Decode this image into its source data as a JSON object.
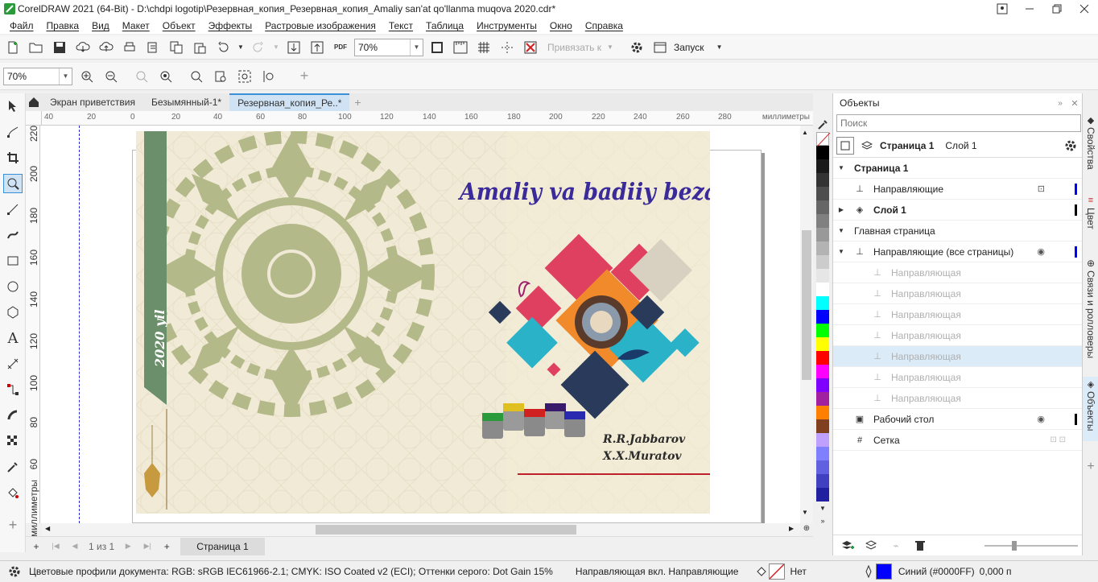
{
  "window": {
    "title": "CorelDRAW 2021 (64-Bit) - D:\\chdpi logotip\\Резервная_копия_Резервная_копия_Amaliy san'at qo'llanma muqova 2020.cdr*"
  },
  "menu": [
    "Файл",
    "Правка",
    "Вид",
    "Макет",
    "Объект",
    "Эффекты",
    "Растровые изображения",
    "Текст",
    "Таблица",
    "Инструменты",
    "Окно",
    "Справка"
  ],
  "stdbar": {
    "zoom": "70%",
    "snap_label": "Привязать к",
    "launch_label": "Запуск"
  },
  "propbar": {
    "zoom": "70%"
  },
  "doc_tabs": [
    "Экран приветствия",
    "Безымянный-1*",
    "Резервная_копия_Ре..*"
  ],
  "ruler": {
    "h_labels": [
      "40",
      "20",
      "0",
      "20",
      "40",
      "60",
      "80",
      "100",
      "120",
      "140",
      "160",
      "180",
      "200",
      "220",
      "240",
      "260",
      "280"
    ],
    "h_unit": "миллиметры",
    "v_labels": [
      "220",
      "200",
      "180",
      "160",
      "140",
      "120",
      "100",
      "80",
      "60"
    ],
    "v_unit": "миллиметры"
  },
  "cover": {
    "banner_text": "2020 yil",
    "title": "Amaliy va badiiy bezak san'ati",
    "authors": [
      "R.R.Jabbarov",
      "X.X.Muratov"
    ],
    "colors": {
      "banner": "#6b8f6b",
      "title": "#3a2a9a",
      "ornament": "#b4b98a",
      "pink": "#e04060",
      "orange": "#f08a2a",
      "teal": "#2ab3c8",
      "navy": "#2a3a5a",
      "red_line": "#c0202a"
    }
  },
  "pagebar": {
    "page_info": "1 из 1",
    "page_tab": "Страница 1"
  },
  "palette": [
    "#000000",
    "#1a1a1a",
    "#333333",
    "#4d4d4d",
    "#666666",
    "#808080",
    "#999999",
    "#b3b3b3",
    "#cccccc",
    "#e6e6e6",
    "#ffffff",
    "#00ffff",
    "#0000ff",
    "#00ff00",
    "#ffff00",
    "#ff0000",
    "#ff00ff",
    "#8000ff",
    "#a020a0",
    "#ff8000",
    "#804020",
    "#c0a0ff",
    "#8080ff",
    "#6060e0",
    "#4040c0",
    "#2020a0"
  ],
  "panel": {
    "title": "Объекты",
    "search_placeholder": "Поиск",
    "page_label": "Страница 1",
    "layer_label": "Слой 1",
    "rows": [
      {
        "label": "Страница 1",
        "bold": true,
        "indent": 0
      },
      {
        "label": "Направляющие",
        "bold": false,
        "indent": 1
      },
      {
        "label": "Слой 1",
        "bold": true,
        "indent": 1
      },
      {
        "label": "Главная страница",
        "bold": false,
        "indent": 0
      },
      {
        "label": "Направляющие (все страницы)",
        "bold": false,
        "indent": 1
      },
      {
        "label": "Направляющая",
        "bold": false,
        "indent": 2,
        "faded": true
      },
      {
        "label": "Направляющая",
        "bold": false,
        "indent": 2,
        "faded": true
      },
      {
        "label": "Направляющая",
        "bold": false,
        "indent": 2,
        "faded": true
      },
      {
        "label": "Направляющая",
        "bold": false,
        "indent": 2,
        "faded": true
      },
      {
        "label": "Направляющая",
        "bold": false,
        "indent": 2,
        "faded": true,
        "selected": true
      },
      {
        "label": "Направляющая",
        "bold": false,
        "indent": 2,
        "faded": true
      },
      {
        "label": "Направляющая",
        "bold": false,
        "indent": 2,
        "faded": true
      },
      {
        "label": "Рабочий стол",
        "bold": false,
        "indent": 1
      },
      {
        "label": "Сетка",
        "bold": false,
        "indent": 1
      }
    ]
  },
  "right_tabs": [
    "Свойства",
    "Цвет",
    "Связи и ролловеры",
    "Объекты"
  ],
  "status": {
    "profiles": "Цветовые профили документа: RGB: sRGB IEC61966-2.1; CMYK: ISO Coated v2 (ECI); Оттенки серого: Dot Gain 15%",
    "snap_info": "Направляющая вкл. Направляющие",
    "fill_label": "Нет",
    "outline_label": "Синий (#0000FF)",
    "outline_width": "0,000 п"
  }
}
